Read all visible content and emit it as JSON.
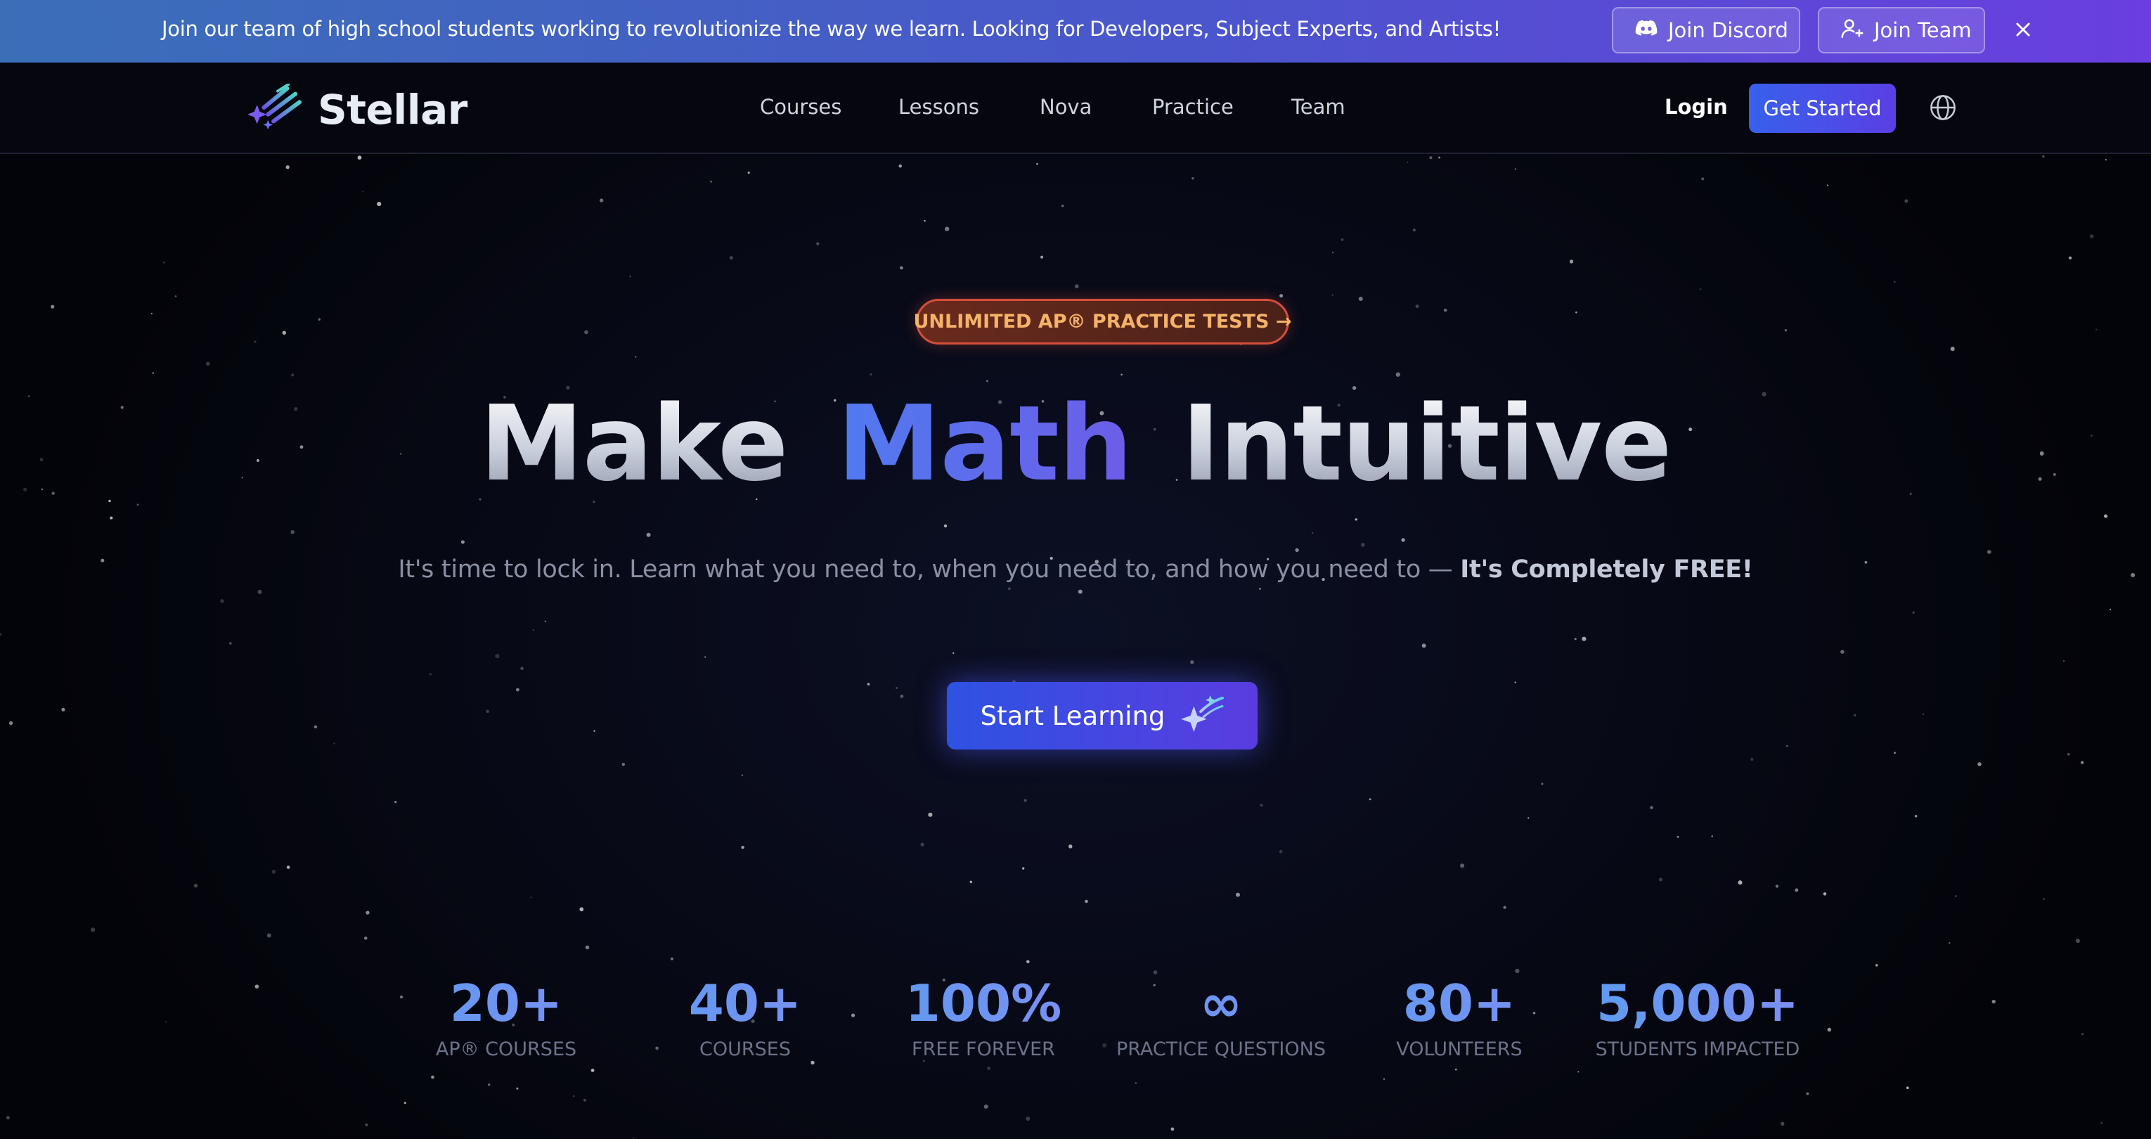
{
  "announcement": {
    "text": "Join our team of high school students working to revolutionize the way we learn. Looking for Developers, Subject Experts, and Artists!",
    "discord_button": "Join Discord",
    "team_button": "Join Team"
  },
  "header": {
    "brand": "Stellar",
    "nav": [
      "Courses",
      "Lessons",
      "Nova",
      "Practice",
      "Team"
    ],
    "login": "Login",
    "cta": "Get Started"
  },
  "hero": {
    "badge": "UNLIMITED AP® PRACTICE TESTS →",
    "headline_pre": "Make",
    "headline_accent": "Math",
    "headline_post": "Intuitive",
    "subline": "It's time to lock in. Learn what you need to, when you need to, and how you need to — ",
    "subline_bold": "It's Completely FREE!",
    "cta": "Start Learning"
  },
  "stats": [
    {
      "value": "20+",
      "label": "AP® COURSES"
    },
    {
      "value": "40+",
      "label": "COURSES"
    },
    {
      "value": "100%",
      "label": "FREE FOREVER"
    },
    {
      "value": "∞",
      "label": "PRACTICE QUESTIONS"
    },
    {
      "value": "80+",
      "label": "VOLUNTEERS"
    },
    {
      "value": "5,000+",
      "label": "STUDENTS IMPACTED"
    }
  ],
  "colors": {
    "accent_blue": "#3860ec",
    "accent_purple": "#5a3fe4",
    "badge_border": "#d54e3c",
    "badge_text": "#f5b36a",
    "stat_value": "#6b95f0"
  },
  "icons": {
    "discord": "discord-icon",
    "join_team": "user-plus-icon",
    "close": "close-icon",
    "globe": "globe-icon",
    "logo": "shooting-stars-logo",
    "cta": "sparkle-star-icon"
  }
}
